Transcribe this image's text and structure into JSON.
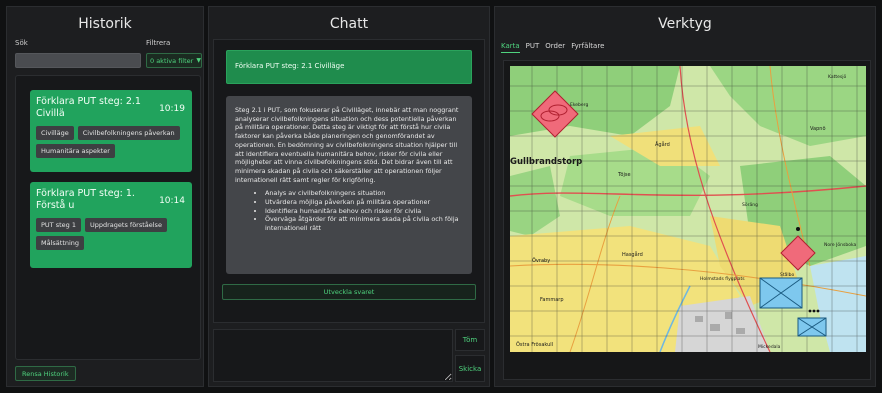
{
  "historik": {
    "title": "Historik",
    "search_label": "Sök",
    "filter_label": "Filtrera",
    "search_value": "",
    "filter_value": "0 aktiva filter",
    "cards": [
      {
        "title": "Förklara PUT steg: 2.1 Civillä",
        "time": "10:19",
        "tags": [
          "Civilläge",
          "Civilbefolkningens påverkan",
          "Humanitära aspekter"
        ]
      },
      {
        "title": "Förklara PUT steg: 1. Förstå u",
        "time": "10:14",
        "tags": [
          "PUT steg 1",
          "Uppdragets förståelse",
          "Målsättning"
        ]
      }
    ],
    "clear_label": "Rensa Historik"
  },
  "chatt": {
    "title": "Chatt",
    "user_message": "Förklara PUT steg: 2.1 Civilläge",
    "bot_paragraph": "Steg 2.1 i PUT, som fokuserar på Civilläget, innebär att man noggrant analyserar civilbefolkningens situation och dess potentiella påverkan på militära operationer. Detta steg är viktigt för att förstå hur civila faktorer kan påverka både planeringen och genomförandet av operationen. En bedömning av civilbefolkningens situation hjälper till att identifiera eventuella humanitära behov, risker för civila eller möjligheter att vinna civilbefolkningens stöd. Det bidrar även till att minimera skadan på civila och säkerställer att operationen följer internationell rätt samt regler för krigföring.",
    "bot_bullets": [
      "Analys av civilbefolkningens situation",
      "Utvärdera möjliga påverkan på militära operationer",
      "Identifiera humanitära behov och risker för civila",
      "Överväga åtgärder för att minimera skada på civila och följa internationell rätt"
    ],
    "expand_label": "Utveckla svaret",
    "input_value": "",
    "clear_label": "Töm",
    "send_label": "Skicka"
  },
  "verktyg": {
    "title": "Verktyg",
    "tabs": [
      "Karta",
      "PUT",
      "Order",
      "Fyrfältare"
    ],
    "active_tab": "Karta",
    "map_labels": {
      "l1": "Gullbrandstorp",
      "l2": "Ågård",
      "l3": "Vapnö",
      "l4": "Töjse",
      "l5": "Övraby",
      "l6": "Hasgård",
      "l7": "Fammarp",
      "l8": "Holmstads flygplats",
      "l9": "Östra Frösakull",
      "l10": "Kattesjö",
      "l11": "Söräng",
      "l12": "Nore Jönsboka",
      "l13": "Ekeberg",
      "l14": "Stålbo",
      "l15": "Mickedala"
    },
    "colors": {
      "accent": "#4fd37e",
      "card": "#21a35d",
      "hostile": "#f06a7a",
      "friendly": "#7ec8ee"
    }
  }
}
